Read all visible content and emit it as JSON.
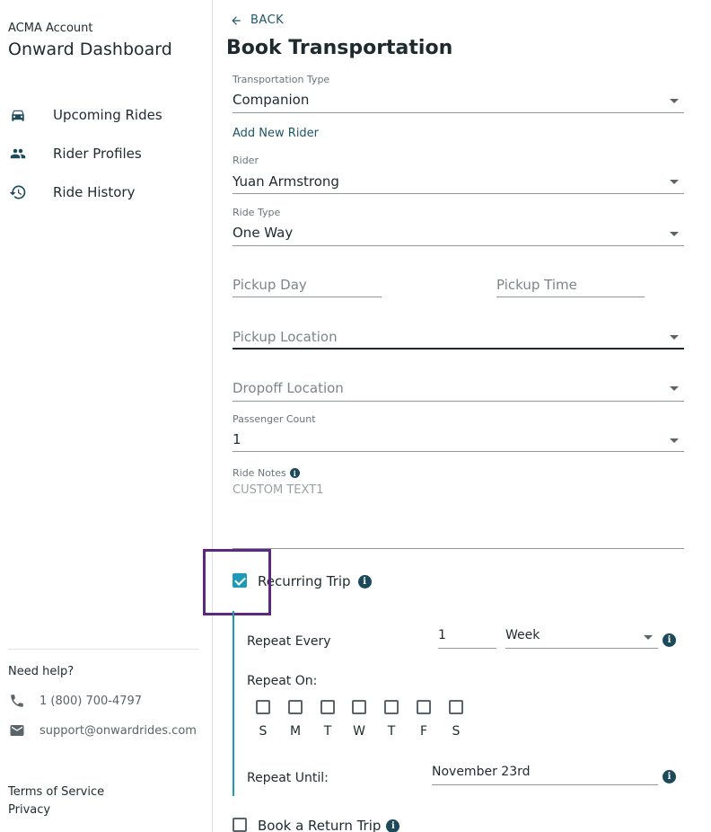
{
  "sidebar": {
    "account_label": "ACMA Account",
    "title": "Onward Dashboard",
    "nav": [
      {
        "label": "Upcoming Rides",
        "icon": "car-icon"
      },
      {
        "label": "Rider Profiles",
        "icon": "people-icon"
      },
      {
        "label": "Ride History",
        "icon": "history-icon"
      }
    ],
    "help": {
      "title": "Need help?",
      "phone": "1 (800) 700-4797",
      "email": "support@onwardrides.com"
    },
    "footer": {
      "terms": "Terms of Service",
      "privacy": "Privacy"
    }
  },
  "main": {
    "back_label": "BACK",
    "title": "Book Transportation",
    "transportation_type": {
      "label": "Transportation Type",
      "value": "Companion"
    },
    "add_rider_label": "Add New Rider",
    "rider": {
      "label": "Rider",
      "value": "Yuan Armstrong"
    },
    "ride_type": {
      "label": "Ride Type",
      "value": "One Way"
    },
    "pickup_day": {
      "placeholder": "Pickup Day"
    },
    "pickup_time": {
      "placeholder": "Pickup Time"
    },
    "pickup_location": {
      "placeholder": "Pickup Location"
    },
    "dropoff_location": {
      "placeholder": "Dropoff Location"
    },
    "passenger_count": {
      "label": "Passenger Count",
      "value": "1"
    },
    "ride_notes": {
      "label": "Ride Notes",
      "value": "CUSTOM TEXT1"
    },
    "recurring": {
      "label": "Recurring Trip",
      "checked": true,
      "repeat_every_label": "Repeat Every",
      "repeat_every_value": "1",
      "repeat_unit": "Week",
      "repeat_on_label": "Repeat On:",
      "days": [
        "S",
        "M",
        "T",
        "W",
        "T",
        "F",
        "S"
      ],
      "repeat_until_label": "Repeat Until:",
      "repeat_until_value": "November 23rd"
    },
    "return_trip": {
      "label": "Book a Return Trip",
      "checked": false
    }
  },
  "colors": {
    "accent": "#1e9ab8",
    "link": "#1d5566",
    "focus_outline": "#5a2a82",
    "text": "#1f2a2e"
  }
}
